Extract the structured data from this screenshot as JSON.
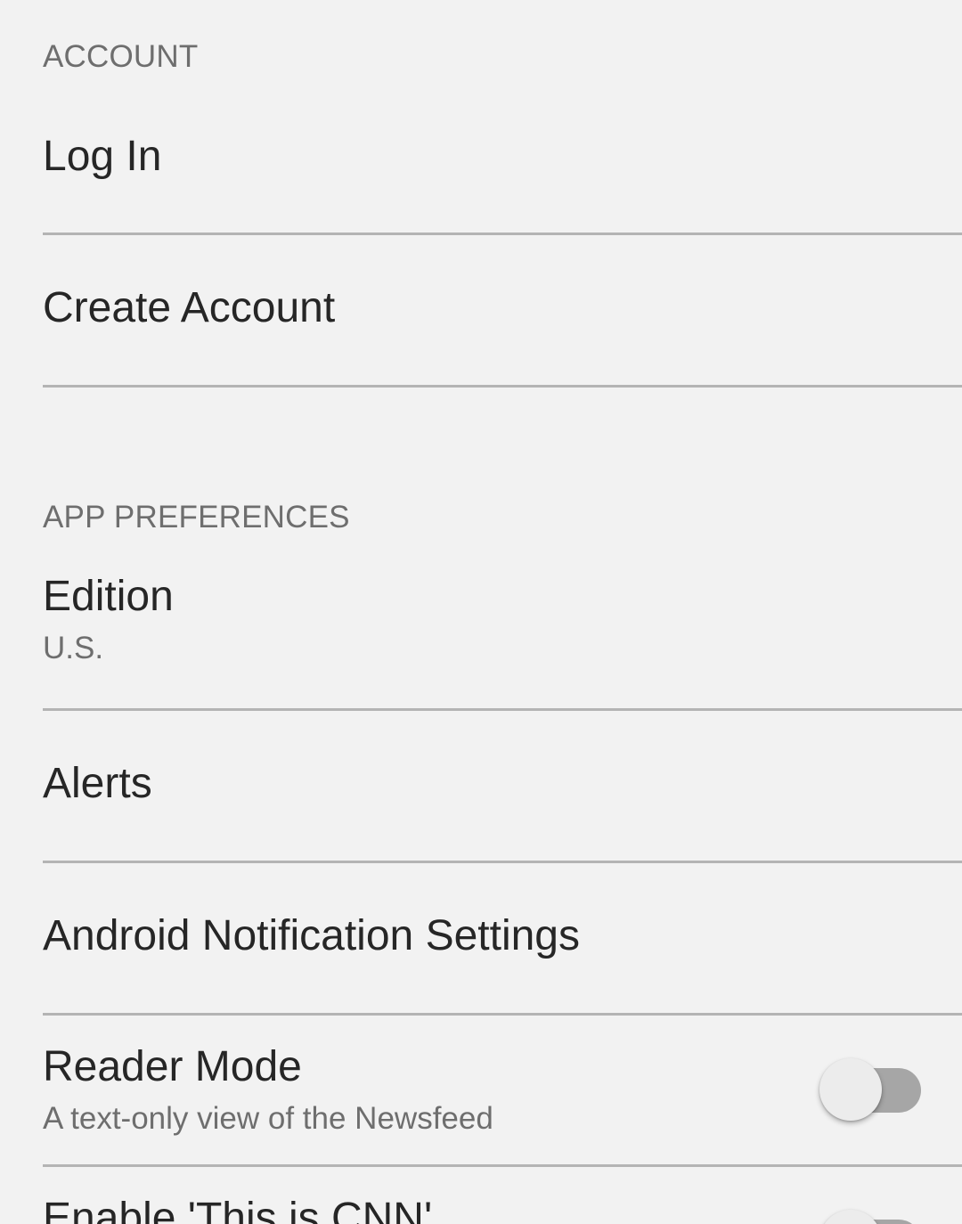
{
  "account": {
    "header": "ACCOUNT",
    "log_in": "Log In",
    "create_account": "Create Account"
  },
  "app_preferences": {
    "header": "APP PREFERENCES",
    "edition": {
      "title": "Edition",
      "value": "U.S."
    },
    "alerts": "Alerts",
    "android_notification_settings": "Android Notification Settings",
    "reader_mode": {
      "title": "Reader Mode",
      "subtitle": "A text-only view of the Newsfeed",
      "enabled": false
    },
    "enable_this_is_cnn": {
      "title": "Enable 'This is CNN'",
      "enabled": false
    }
  },
  "colors": {
    "background": "#f2f2f2",
    "divider": "#b4b4b4",
    "toggle_track_off": "#a6a6a6",
    "toggle_thumb": "#ececec"
  }
}
